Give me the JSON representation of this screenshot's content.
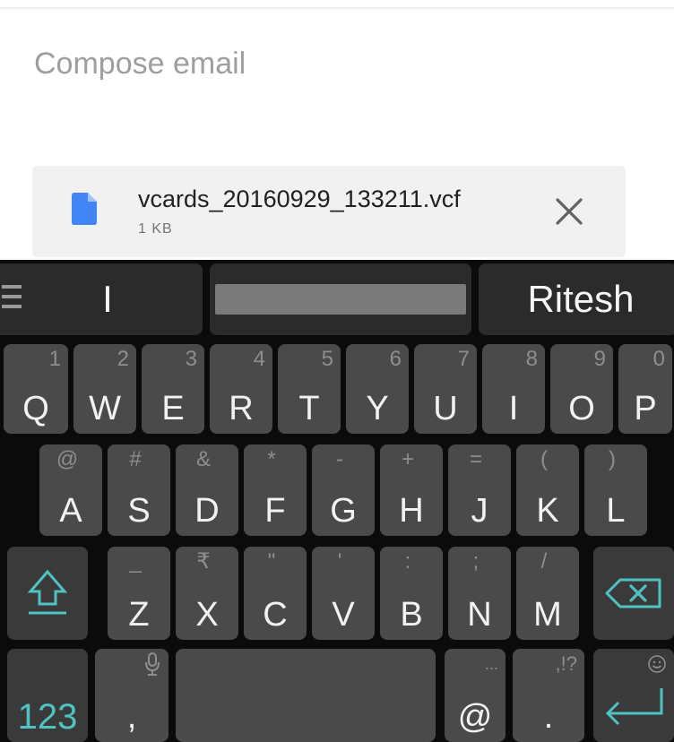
{
  "compose": {
    "placeholder": "Compose email"
  },
  "attachment": {
    "file_name": "vcards_20160929_133211.vcf",
    "file_size": "1 KB",
    "icon": "document-icon",
    "close_icon": "close-icon"
  },
  "keyboard": {
    "suggestions": [
      "I",
      "",
      "Ritesh"
    ],
    "row1": [
      {
        "main": "Q",
        "hint": "1"
      },
      {
        "main": "W",
        "hint": "2"
      },
      {
        "main": "E",
        "hint": "3"
      },
      {
        "main": "R",
        "hint": "4"
      },
      {
        "main": "T",
        "hint": "5"
      },
      {
        "main": "Y",
        "hint": "6"
      },
      {
        "main": "U",
        "hint": "7"
      },
      {
        "main": "I",
        "hint": "8"
      },
      {
        "main": "O",
        "hint": "9"
      },
      {
        "main": "P",
        "hint": "0"
      }
    ],
    "row2": [
      {
        "main": "A",
        "hint": "@"
      },
      {
        "main": "S",
        "hint": "#"
      },
      {
        "main": "D",
        "hint": "&"
      },
      {
        "main": "F",
        "hint": "*"
      },
      {
        "main": "G",
        "hint": "-"
      },
      {
        "main": "H",
        "hint": "+"
      },
      {
        "main": "J",
        "hint": "="
      },
      {
        "main": "K",
        "hint": "("
      },
      {
        "main": "L",
        "hint": ")"
      }
    ],
    "row3": [
      {
        "main": "Z",
        "hint": "_"
      },
      {
        "main": "X",
        "hint": "₹"
      },
      {
        "main": "C",
        "hint": "\""
      },
      {
        "main": "V",
        "hint": "'"
      },
      {
        "main": "B",
        "hint": ":"
      },
      {
        "main": "N",
        "hint": ";"
      },
      {
        "main": "M",
        "hint": "/"
      }
    ],
    "numbers_key": "123",
    "comma_key": ",",
    "at_key": "@",
    "at_hint": "...",
    "period_key": ".",
    "period_hint": ",!?",
    "accent_color": "#4fc3c3"
  }
}
